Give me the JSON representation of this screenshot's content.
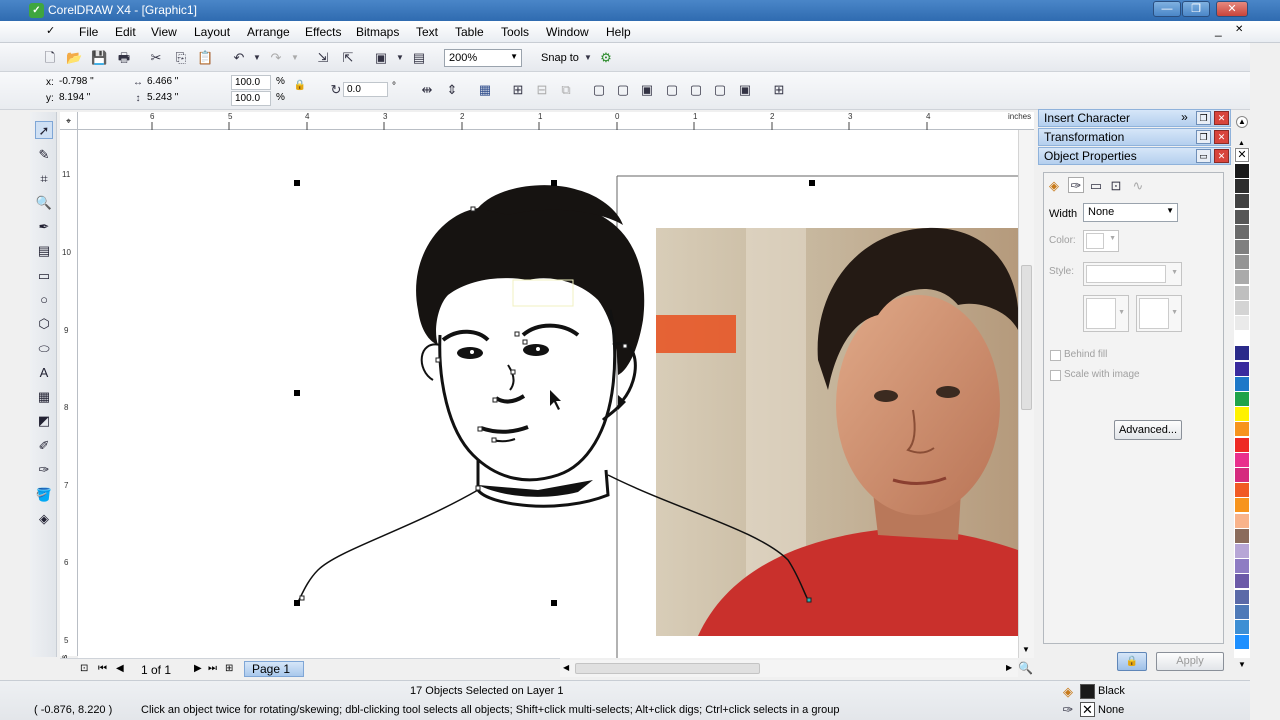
{
  "window": {
    "title": "CorelDRAW X4 - [Graphic1]",
    "app_icon": "coreldraw-icon",
    "controls": [
      "—",
      "❐",
      "✕"
    ]
  },
  "menu": [
    "File",
    "Edit",
    "View",
    "Layout",
    "Arrange",
    "Effects",
    "Bitmaps",
    "Text",
    "Table",
    "Tools",
    "Window",
    "Help"
  ],
  "standard_toolbar": {
    "zoom_value": "200%",
    "snap_to_label": "Snap to"
  },
  "property_bar": {
    "x_label": "x:",
    "x_value": "-0.798 \"",
    "y_label": "y:",
    "y_value": "8.194 \"",
    "width_value": "6.466 \"",
    "height_value": "5.243 \"",
    "scale_x": "100.0",
    "scale_y": "100.0",
    "percent": "%",
    "rotation": "0.0",
    "degree": "°"
  },
  "ruler": {
    "h_units": "inches",
    "h_ticks": [
      "6",
      "5",
      "4",
      "3",
      "2",
      "1",
      "0",
      "1",
      "2",
      "3",
      "4"
    ],
    "v_ticks": [
      "11",
      "10",
      "9",
      "8",
      "7",
      "6",
      "5"
    ],
    "v_units": "inches"
  },
  "page_nav": {
    "page_count": "1 of 1",
    "page_tab": "Page 1"
  },
  "dockers": {
    "insert_character": "Insert Character",
    "transformation": "Transformation",
    "object_properties": "Object Properties"
  },
  "object_properties": {
    "width_label": "Width",
    "width_value": "None",
    "color_label": "Color:",
    "style_label": "Style:",
    "behind_fill": "Behind fill",
    "scale_with_image": "Scale with image",
    "advanced_button": "Advanced...",
    "apply_button": "Apply"
  },
  "palette_colors": [
    "#1a1a1a",
    "#2e2e2e",
    "#424242",
    "#575757",
    "#6b6b6b",
    "#808080",
    "#959595",
    "#aaaaaa",
    "#bfbfbf",
    "#d4d4d4",
    "#eaeaea",
    "#ffffff",
    "#2b2b8a",
    "#3a2b9e",
    "#1e78c8",
    "#1fa34a",
    "#fff200",
    "#f7941d",
    "#ee2a24",
    "#e9308d",
    "#d52b7e",
    "#f15a24",
    "#f7941d",
    "#f9b38a",
    "#8b6c5c",
    "#b7a6d6",
    "#8e7cc3",
    "#6c5aa8",
    "#5b6aa8",
    "#4f7ab8",
    "#3e8fd4",
    "#1e90ff"
  ],
  "status": {
    "selection": "17 Objects Selected on Layer 1",
    "coords": "( -0.876, 8.220 )",
    "hint": "Click an object twice for rotating/skewing; dbl-clicking tool selects all objects; Shift+click multi-selects; Alt+click digs; Ctrl+click selects in a group",
    "fill_label": "Black",
    "outline_label": "None",
    "fill_color": "#1a1a1a"
  }
}
